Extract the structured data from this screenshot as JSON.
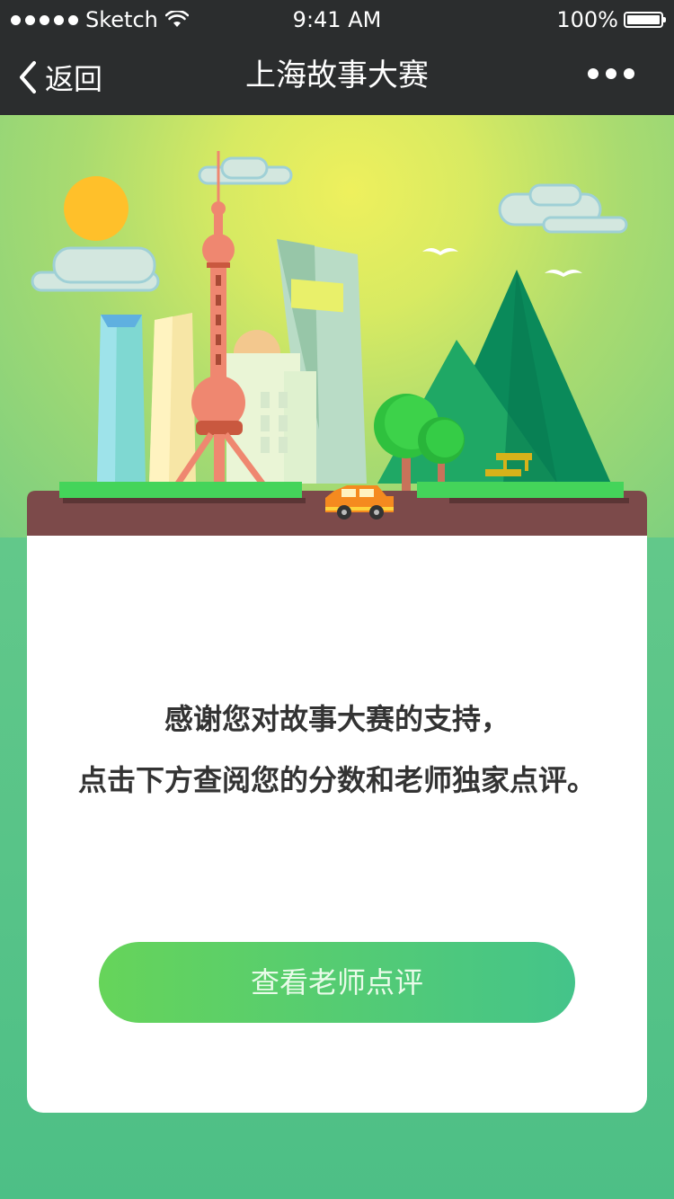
{
  "status_bar": {
    "carrier": "Sketch",
    "time": "9:41 AM",
    "battery": "100%"
  },
  "nav": {
    "back_label": "返回",
    "title": "上海故事大赛",
    "more_icon": "more-dots-icon"
  },
  "illustration": {
    "scene": "shanghai-skyline-illustration"
  },
  "card": {
    "message_line1": "感谢您对故事大赛的支持，",
    "message_line2": "点击下方查阅您的分数和老师独家点评。",
    "button_label": "查看老师点评"
  },
  "colors": {
    "nav_background": "#2b2d2e",
    "button_gradient_start": "#66d45a",
    "button_gradient_end": "#44c48a",
    "page_background": "#62c88a"
  }
}
